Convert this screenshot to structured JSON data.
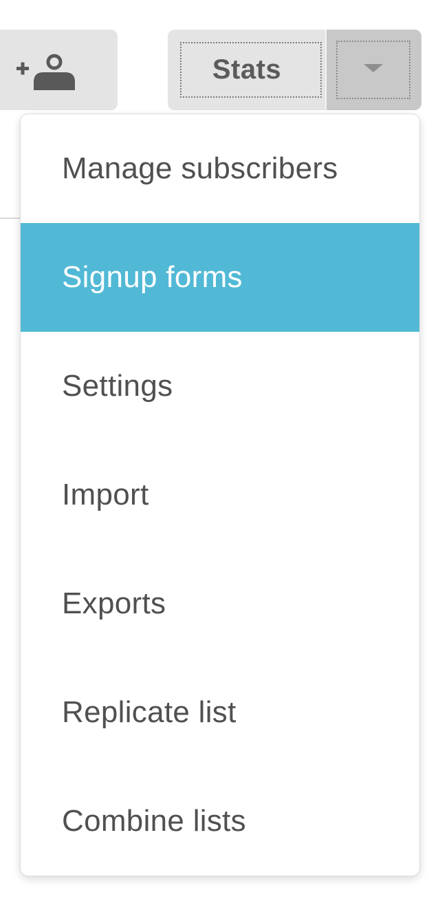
{
  "toolbar": {
    "add_subscriber_icon": "add-user-icon",
    "stats_label": "Stats",
    "toggle_icon": "caret-down-icon"
  },
  "menu": {
    "active_index": 1,
    "active_color": "#51b9d6",
    "items": [
      {
        "label": "Manage subscribers"
      },
      {
        "label": "Signup forms"
      },
      {
        "label": "Settings"
      },
      {
        "label": "Import"
      },
      {
        "label": "Exports"
      },
      {
        "label": "Replicate list"
      },
      {
        "label": "Combine lists"
      }
    ]
  }
}
